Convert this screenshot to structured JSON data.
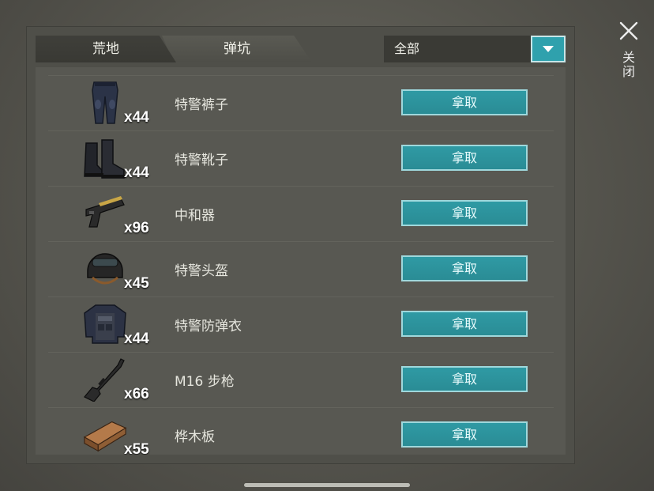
{
  "tabs": [
    {
      "label": "荒地",
      "active": true
    },
    {
      "label": "弹坑",
      "active": false
    }
  ],
  "filter": {
    "selected": "全部"
  },
  "close": {
    "label": "关闭",
    "icon": "close-icon"
  },
  "items": [
    {
      "name": "特警裤子",
      "qty": "x44",
      "icon": "pants-icon",
      "action": "拿取"
    },
    {
      "name": "特警靴子",
      "qty": "x44",
      "icon": "boots-icon",
      "action": "拿取"
    },
    {
      "name": "中和器",
      "qty": "x96",
      "icon": "pistol-icon",
      "action": "拿取"
    },
    {
      "name": "特警头盔",
      "qty": "x45",
      "icon": "helmet-icon",
      "action": "拿取"
    },
    {
      "name": "特警防弹衣",
      "qty": "x44",
      "icon": "vest-icon",
      "action": "拿取"
    },
    {
      "name": "M16 步枪",
      "qty": "x66",
      "icon": "rifle-icon",
      "action": "拿取"
    },
    {
      "name": "桦木板",
      "qty": "x55",
      "icon": "plank-icon",
      "action": "拿取"
    }
  ],
  "colors": {
    "accent": "#2fa1ad",
    "panel": "#4f4f49",
    "list": "#585852"
  }
}
